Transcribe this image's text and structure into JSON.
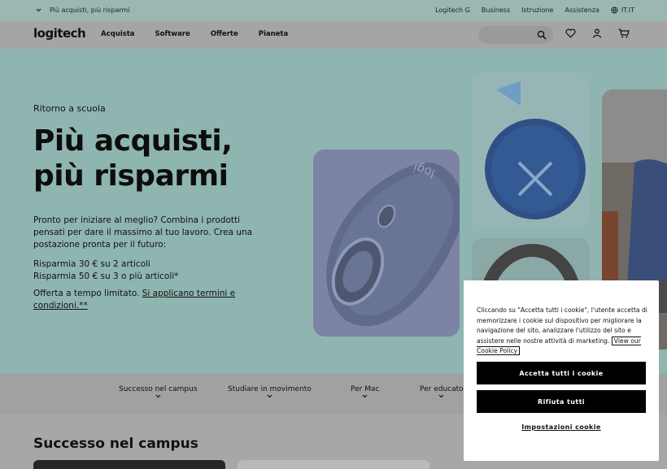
{
  "topbar": {
    "promo": "Più acquisti, più risparmi",
    "links": [
      "Logitech G",
      "Business",
      "Istruzione",
      "Assistenza"
    ],
    "locale": "IT.IT"
  },
  "nav": {
    "logo": "logitech",
    "links": [
      "Acquista",
      "Software",
      "Offerte",
      "Pianeta"
    ]
  },
  "hero": {
    "eyebrow": "Ritorno a scuola",
    "headline_1": "Più acquisti,",
    "headline_2": "più risparmi",
    "copy": "Pronto per iniziare al meglio? Combina i prodotti pensati per dare il massimo al tuo lavoro. Crea una postazione pronta per il futuro:",
    "offer_1": "Risparmia 30 € su 2 articoli",
    "offer_2": "Risparmia 50 € su 3 o più articoli*",
    "limited_prefix": "Offerta a tempo limitato.",
    "limited_link": "Si applicano termini e condizioni.**"
  },
  "categories": [
    "Successo nel campus",
    "Studiare in movimento",
    "Per Mac",
    "Per educato"
  ],
  "section": {
    "title": "Successo nel campus"
  },
  "cookie": {
    "text": "Cliccando su \"Accetta tutti i cookie\", l'utente accetta di memorizzare i cookie sul dispositivo per migliorare la navigazione del sito, analizzare l'utilizzo del sito e assistere nelle nostre attività di marketing.",
    "policy_link": "View our Cookie Policy",
    "accept": "Accetta tutti i cookie",
    "reject": "Rifiuta tutti",
    "settings": "Impostazioni cookie"
  }
}
